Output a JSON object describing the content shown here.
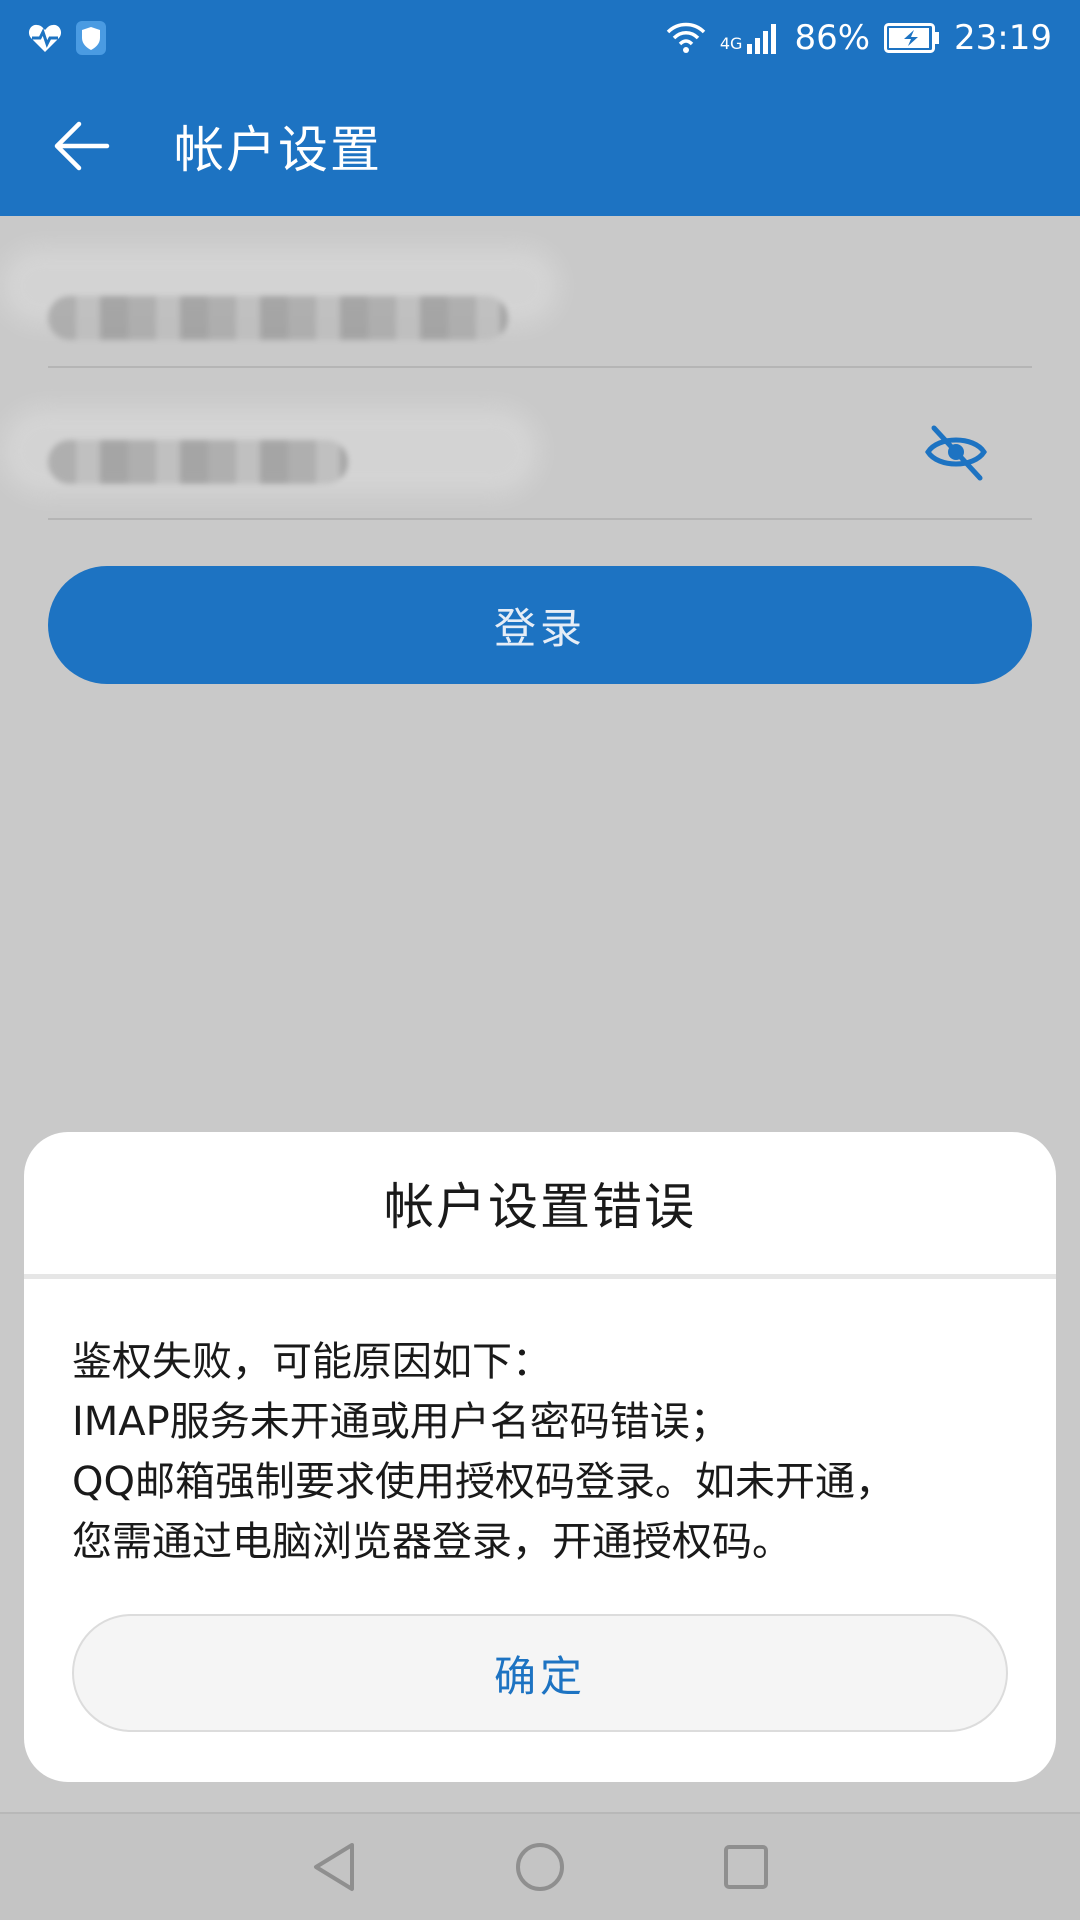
{
  "status_bar": {
    "network": "4G",
    "battery": "86%",
    "time": "23:19",
    "icons": [
      "health-icon",
      "shield-icon",
      "wifi-icon",
      "signal-icon",
      "battery-icon"
    ]
  },
  "app_bar": {
    "title": "帐户设置",
    "back_icon": "arrow-back-icon"
  },
  "form": {
    "email_value": "",
    "password_value": "",
    "password_toggle_icon": "eye-off-icon",
    "login_label": "登录"
  },
  "dialog": {
    "title": "帐户设置错误",
    "message_lines": [
      "鉴权失败，可能原因如下：",
      "IMAP服务未开通或用户名密码错误；",
      "QQ邮箱强制要求使用授权码登录。如未开通，",
      "您需通过电脑浏览器登录，开通授权码。"
    ],
    "confirm_label": "确定"
  },
  "nav_bar": {
    "buttons": [
      "back-triangle-icon",
      "home-circle-icon",
      "recents-square-icon"
    ]
  },
  "colors": {
    "primary": "#1d73c2",
    "dim_background": "#c9c9c9",
    "dialog_background": "#ffffff"
  }
}
